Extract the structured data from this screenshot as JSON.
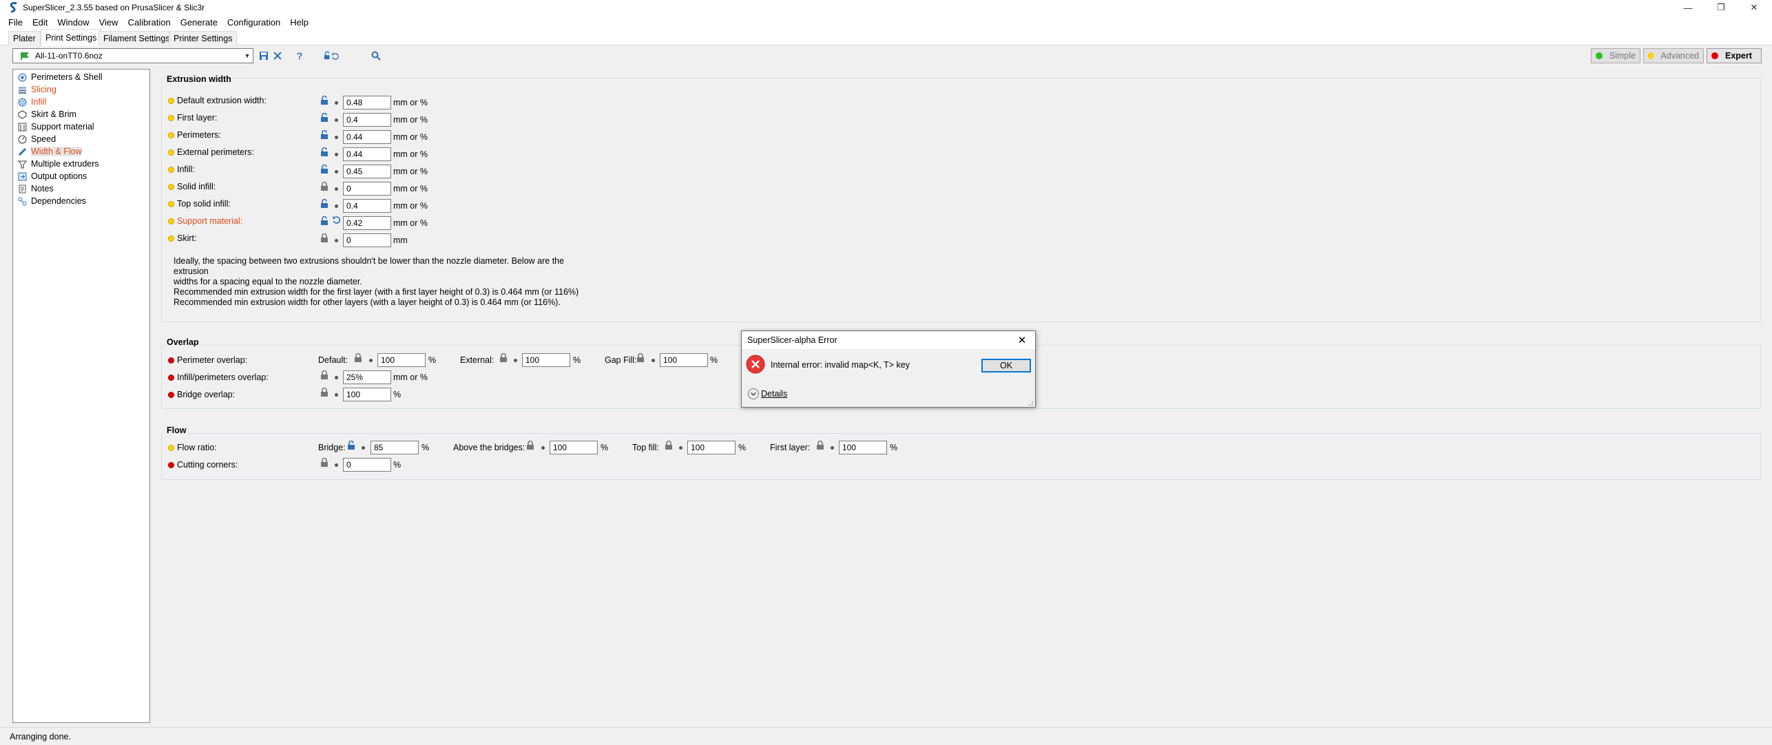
{
  "window": {
    "title": "SuperSlicer_2.3.55 based on PrusaSlicer & Slic3r",
    "minimize_icon": "minimize-icon",
    "maximize_icon": "restore-icon",
    "close_icon": "close-icon"
  },
  "menu": [
    "File",
    "Edit",
    "Window",
    "View",
    "Calibration",
    "Generate",
    "Configuration",
    "Help"
  ],
  "tabs": [
    "Plater",
    "Print Settings",
    "Filament Settings",
    "Printer Settings"
  ],
  "active_tab": "Print Settings",
  "preset": {
    "name": "All-11-onTT0.6noz",
    "icons": [
      "save-icon",
      "delete-icon",
      "question-icon",
      "lock-undo-icon",
      "search-icon"
    ]
  },
  "modes": [
    {
      "label": "Simple",
      "color": "#27c41f",
      "active": false
    },
    {
      "label": "Advanced",
      "color": "#ffd200",
      "active": false
    },
    {
      "label": "Expert",
      "color": "#e00000",
      "active": true
    }
  ],
  "tree": [
    {
      "label": "Perimeters & Shell",
      "modified": false
    },
    {
      "label": "Slicing",
      "modified": true
    },
    {
      "label": "Infill",
      "modified": true
    },
    {
      "label": "Skirt & Brim",
      "modified": false
    },
    {
      "label": "Support material",
      "modified": false
    },
    {
      "label": "Speed",
      "modified": false
    },
    {
      "label": "Width & Flow",
      "modified": true,
      "selected": true
    },
    {
      "label": "Multiple extruders",
      "modified": false
    },
    {
      "label": "Output options",
      "modified": false
    },
    {
      "label": "Notes",
      "modified": false
    },
    {
      "label": "Dependencies",
      "modified": false
    }
  ],
  "extrusion_width": {
    "title": "Extrusion width",
    "rows": [
      {
        "label": "Default extrusion width:",
        "value": "0.48",
        "unit": "mm or %",
        "modified": false
      },
      {
        "label": "First layer:",
        "value": "0.4",
        "unit": "mm or %",
        "modified": false
      },
      {
        "label": "Perimeters:",
        "value": "0.44",
        "unit": "mm or %",
        "modified": false
      },
      {
        "label": "External perimeters:",
        "value": "0.44",
        "unit": "mm or %",
        "modified": false
      },
      {
        "label": "Infill:",
        "value": "0.45",
        "unit": "mm or %",
        "modified": false
      },
      {
        "label": "Solid infill:",
        "value": "0",
        "unit": "mm or %",
        "modified": false
      },
      {
        "label": "Top solid infill:",
        "value": "0.4",
        "unit": "mm or %",
        "modified": false
      },
      {
        "label": "Support material:",
        "value": "0.42",
        "unit": "mm or %",
        "modified": true
      },
      {
        "label": "Skirt:",
        "value": "0",
        "unit": "mm",
        "modified": false
      }
    ],
    "note": [
      "Ideally, the spacing between two extrusions shouldn't be lower than the nozzle diameter. Below are the extrusion",
      "widths for a spacing equal to the nozzle diameter.",
      "Recommended min extrusion width for the first layer (with a first layer height of 0.3) is 0.464 mm (or 116%)",
      "Recommended min extrusion width for other layers (with a layer height of 0.3) is 0.464 mm (or 116%)."
    ]
  },
  "overlap": {
    "title": "Overlap",
    "perimeter_overlap": {
      "label": "Perimeter overlap:",
      "default_label": "Default:",
      "default_value": "100",
      "default_unit": "%",
      "external_label": "External:",
      "external_value": "100",
      "external_unit": "%",
      "gapfill_label": "Gap Fill:",
      "gapfill_value": "100",
      "gapfill_unit": "%"
    },
    "infill_perimeters": {
      "label": "Infill/perimeters overlap:",
      "value": "25%",
      "unit": "mm or %"
    },
    "bridge_overlap": {
      "label": "Bridge overlap:",
      "value": "100",
      "unit": "%"
    }
  },
  "flow": {
    "title": "Flow",
    "flow_ratio": {
      "label": "Flow ratio:",
      "bridge_label": "Bridge:",
      "bridge_value": "85",
      "bridge_unit": "%",
      "above_label": "Above the bridges:",
      "above_value": "100",
      "above_unit": "%",
      "topfill_label": "Top fill:",
      "topfill_value": "100",
      "topfill_unit": "%",
      "firstlayer_label": "First layer:",
      "firstlayer_value": "100",
      "firstlayer_unit": "%"
    },
    "cutting_corners": {
      "label": "Cutting corners:",
      "value": "0",
      "unit": "%"
    }
  },
  "dialog": {
    "title": "SuperSlicer-alpha Error",
    "message": "Internal error: invalid map<K, T> key",
    "ok_label": "OK",
    "details_label": "Details",
    "icon": "error-icon"
  },
  "status": "Arranging done."
}
